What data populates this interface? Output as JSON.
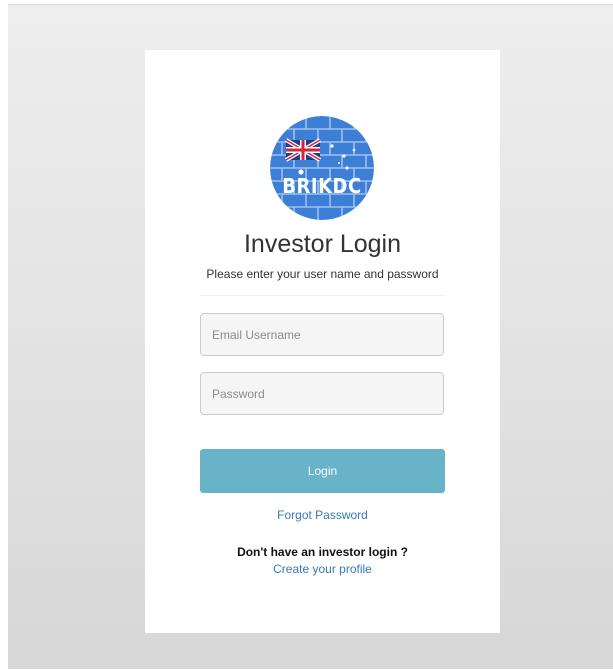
{
  "logo": {
    "text": "BRIKDC",
    "colors": {
      "brick_blue": "#3d7fd6",
      "mortar": "#a9c9ef"
    }
  },
  "login": {
    "title": "Investor Login",
    "subtitle": "Please enter your user name and password",
    "email_placeholder": "Email Username",
    "password_placeholder": "Password",
    "login_label": "Login",
    "forgot_label": "Forgot Password",
    "no_login_text": "Don't have an investor login ?",
    "create_profile_label": "Create your profile"
  },
  "colors": {
    "button": "#68b3c8",
    "link": "#337ab7"
  }
}
